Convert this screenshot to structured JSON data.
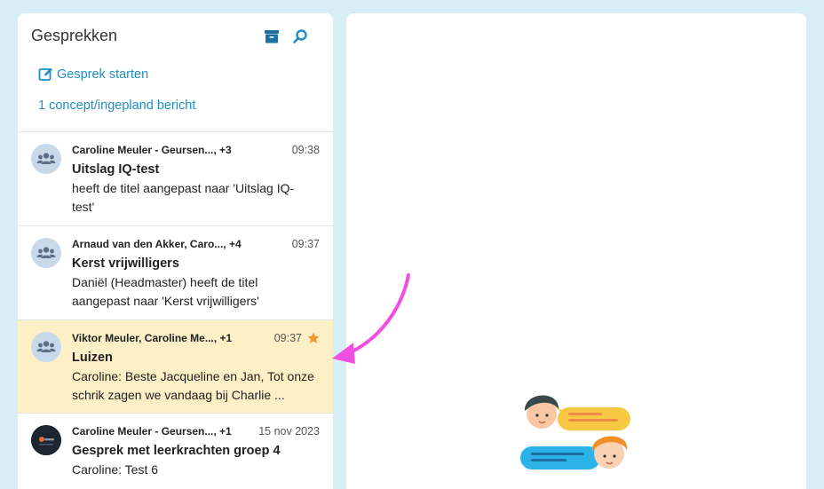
{
  "sidebar": {
    "title": "Gesprekken",
    "start_label": "Gesprek starten",
    "draft_label": "1 concept/ingepland bericht"
  },
  "conversations": [
    {
      "participants": "Caroline Meuler - Geursen..., +3",
      "time": "09:38",
      "subject": "Uitslag IQ-test",
      "preview_lines": [
        "heeft de titel aangepast naar 'Uitslag IQ-",
        "test'"
      ],
      "avatar": "group-icon"
    },
    {
      "participants": "Arnaud van den Akker, Caro..., +4",
      "time": "09:37",
      "subject": "Kerst vrijwilligers",
      "preview_lines": [
        "Daniël (Headmaster) heeft de titel",
        "aangepast naar 'Kerst vrijwilligers'"
      ],
      "avatar": "group-icon"
    },
    {
      "participants": "Viktor Meuler, Caroline Me..., +1",
      "time": "09:37",
      "subject": "Luizen",
      "preview_lines": [
        "Caroline: Beste Jacqueline en Jan, Tot onze",
        "schrik zagen we vandaag bij Charlie ..."
      ],
      "avatar": "group-icon",
      "starred": true,
      "selected": true
    },
    {
      "participants": "Caroline Meuler - Geursen..., +1",
      "time": "15 nov 2023",
      "subject": "Gesprek met leerkrachten groep 4",
      "preview_lines": [
        "Caroline: Test 6"
      ],
      "avatar": "photo-avatar"
    }
  ],
  "colors": {
    "accent": "#1f8fc4",
    "selected_bg": "#fdf0c6",
    "star": "#f0962c",
    "arrow": "#f24fe0",
    "background": "#d7eef7"
  }
}
